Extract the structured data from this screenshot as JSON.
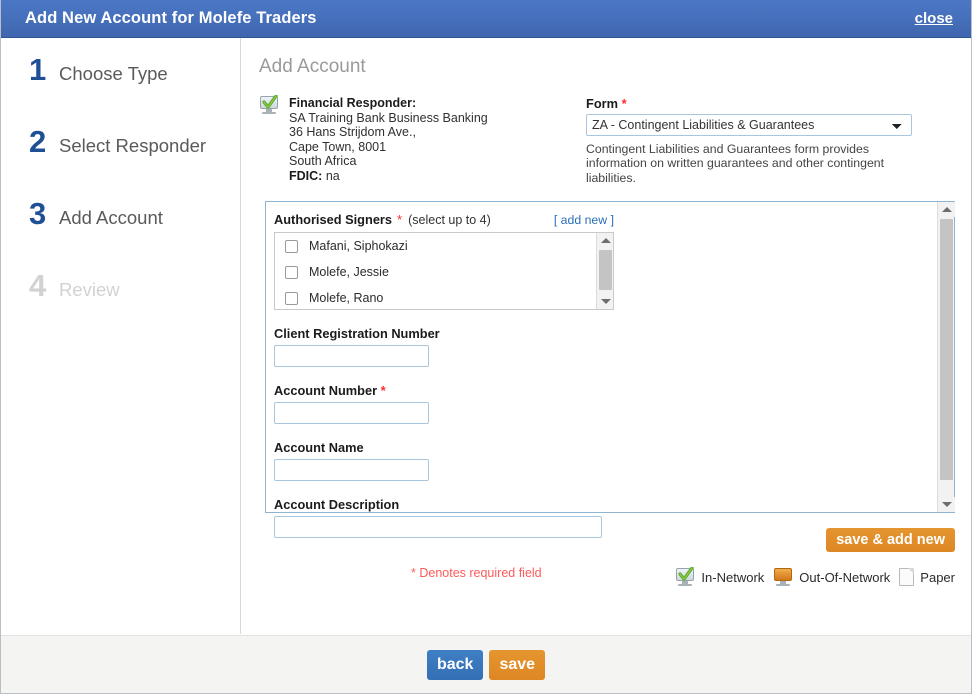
{
  "titlebar": {
    "title": "Add New Account for Molefe Traders",
    "close_label": "close"
  },
  "steps": [
    {
      "num": "1",
      "label": "Choose Type",
      "state": "done"
    },
    {
      "num": "2",
      "label": "Select Responder",
      "state": "done"
    },
    {
      "num": "3",
      "label": "Add Account",
      "state": "current"
    },
    {
      "num": "4",
      "label": "Review",
      "state": "disabled"
    }
  ],
  "main": {
    "page_title": "Add Account",
    "responder": {
      "heading": "Financial Responder:",
      "name": "SA Training Bank Business Banking",
      "address1": "36 Hans Strijdom Ave.,",
      "address2": "Cape Town, 8001",
      "country": "South Africa",
      "fdic_label": "FDIC:",
      "fdic_value": "na",
      "icon": "in-network-monitor-icon"
    },
    "form_select": {
      "label": "Form",
      "required_mark": "*",
      "selected": "ZA - Contingent Liabilities & Guarantees",
      "options": [
        "ZA - Contingent Liabilities & Guarantees"
      ],
      "help_text": "Contingent Liabilities and Guarantees form provides information on written guarantees and other contingent liabilities."
    },
    "signers": {
      "title": "Authorised Signers",
      "required_mark": "*",
      "hint": "(select up to 4)",
      "add_new_label": "[ add new ]",
      "items": [
        {
          "name": "Mafani, Siphokazi",
          "checked": false
        },
        {
          "name": "Molefe, Jessie",
          "checked": false
        },
        {
          "name": "Molefe, Rano",
          "checked": false
        }
      ]
    },
    "fields": [
      {
        "label": "Client Registration Number",
        "required": false,
        "value": "",
        "width": "small"
      },
      {
        "label": "Account Number",
        "required": true,
        "value": "",
        "width": "small"
      },
      {
        "label": "Account Name",
        "required": false,
        "value": "",
        "width": "small"
      },
      {
        "label": "Account Description",
        "required": false,
        "value": "",
        "width": "wide"
      }
    ],
    "save_add_new_label": "save & add new",
    "required_note": "* Denotes required field",
    "legend": [
      {
        "label": "In-Network",
        "icon": "in-network-monitor-icon"
      },
      {
        "label": "Out-Of-Network",
        "icon": "out-of-network-monitor-icon"
      },
      {
        "label": "Paper",
        "icon": "paper-icon"
      }
    ]
  },
  "footer": {
    "back_label": "back",
    "save_label": "save"
  },
  "colors": {
    "title_bar_blue": "#4771bd",
    "step_active_blue": "#1f5096",
    "step_disabled_gray": "#d2d2d2",
    "accent_orange": "#dd8724",
    "button_blue": "#3f7fc4",
    "required_red": "#ff2d2d",
    "link_blue": "#2a6fb8",
    "panel_border": "#8fb4d0"
  }
}
